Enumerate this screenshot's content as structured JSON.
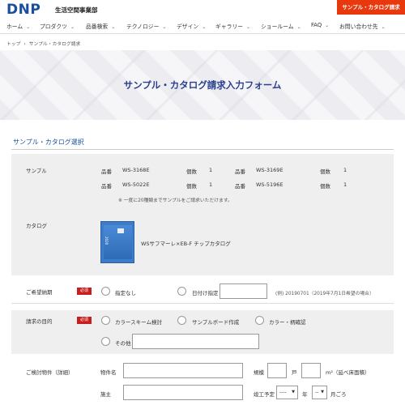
{
  "header": {
    "logo": "DNP",
    "division": "生活空間事業部",
    "request_button": "サンプル・カタログ請求"
  },
  "nav": {
    "items": [
      {
        "label": "ホーム"
      },
      {
        "label": "プロダクツ"
      },
      {
        "label": "品番検索"
      },
      {
        "label": "テクノロジー"
      },
      {
        "label": "デザイン"
      },
      {
        "label": "ギャラリー"
      },
      {
        "label": "ショールーム"
      },
      {
        "label": "FAQ"
      },
      {
        "label": "お問い合わせ先"
      }
    ],
    "chevron": "⌄"
  },
  "breadcrumb": {
    "home": "トップ",
    "separator": "›",
    "current": "サンプル・カタログ請求"
  },
  "banner": {
    "title": "サンプル・カタログ請求入力フォーム"
  },
  "section": {
    "title": "サンプル・カタログ選択"
  },
  "samples": {
    "label": "サンプル",
    "code_label": "品番",
    "qty_label": "個数",
    "items": [
      {
        "code": "WS-3168E",
        "qty": "1"
      },
      {
        "code": "WS-3169E",
        "qty": "1"
      },
      {
        "code": "WS-5022E",
        "qty": "1"
      },
      {
        "code": "WS-5196E",
        "qty": "1"
      }
    ],
    "note": "※ 一度に20種類までサンプルをご請求いただけます。"
  },
  "catalog": {
    "label": "カタログ",
    "item_name": "WSサフマーレ×EB-F チップカタログ",
    "thumb_text": "2020"
  },
  "delivery": {
    "label": "ご希望納期",
    "required": "必須",
    "option_none": "指定なし",
    "option_date": "日付け指定",
    "example": "(例) 20190701（2019年7月1日希望の場合）"
  },
  "purpose": {
    "label": "請求の目的",
    "required": "必須",
    "options": [
      "カラースキーム検討",
      "サンプルボード作成",
      "カラー・柄確認",
      "その他"
    ]
  },
  "property": {
    "label": "ご検討物件（詳細）",
    "name_label": "物件名",
    "scale_label": "規模",
    "unit_houses": "戸",
    "area_unit": "m²（延べ床面積）",
    "owner_label": "施主",
    "completion_label": "竣工予定",
    "year_select": "----",
    "year_unit": "年",
    "month_select": "--",
    "month_unit": "月ごろ"
  }
}
